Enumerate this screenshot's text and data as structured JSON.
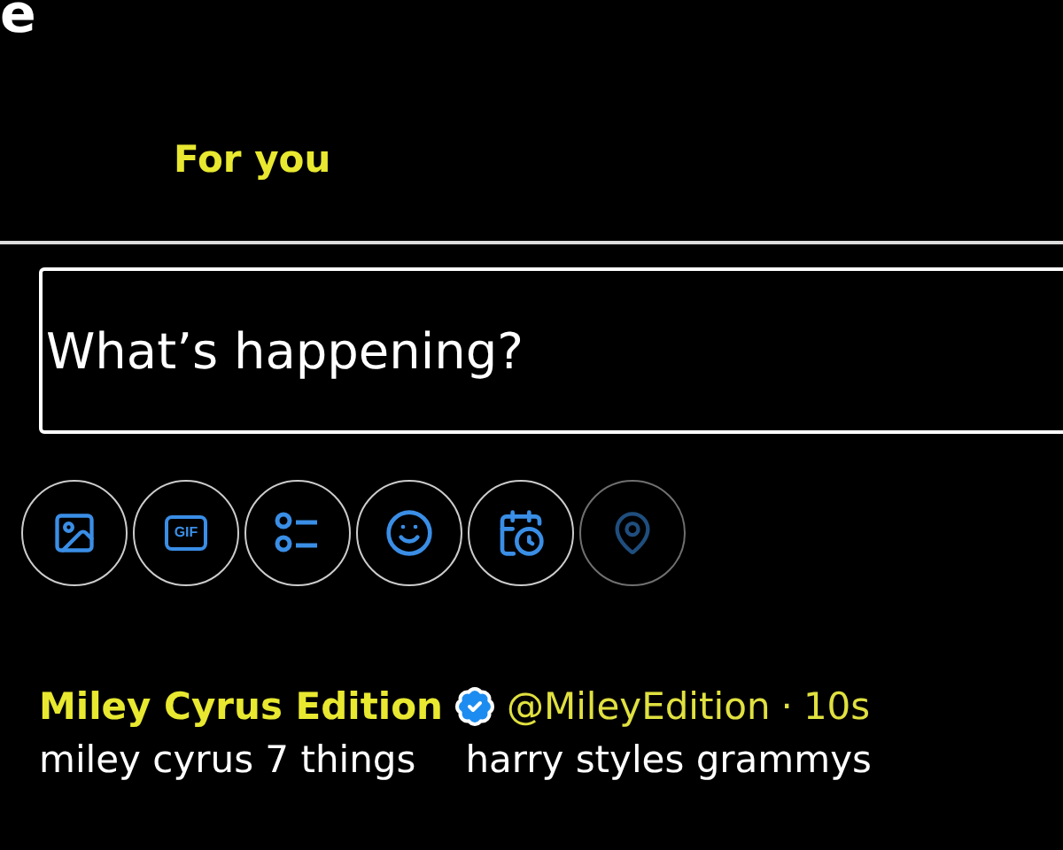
{
  "header": {
    "title_fragment": "e"
  },
  "tabs": [
    {
      "label": "For you",
      "selected": true
    }
  ],
  "composer": {
    "placeholder": "What’s happening?",
    "tools": [
      {
        "kind": "image",
        "disabled": false
      },
      {
        "kind": "gif",
        "label": "GIF",
        "disabled": false
      },
      {
        "kind": "poll",
        "disabled": false
      },
      {
        "kind": "emoji",
        "disabled": false
      },
      {
        "kind": "schedule",
        "disabled": false
      },
      {
        "kind": "location",
        "disabled": true
      }
    ]
  },
  "post": {
    "name": "Miley Cyrus Edition",
    "verified": true,
    "handle": "@MileyEdition",
    "separator": "·",
    "time": "10s",
    "texts": [
      "miley cyrus 7 things",
      "harry styles grammys"
    ]
  }
}
